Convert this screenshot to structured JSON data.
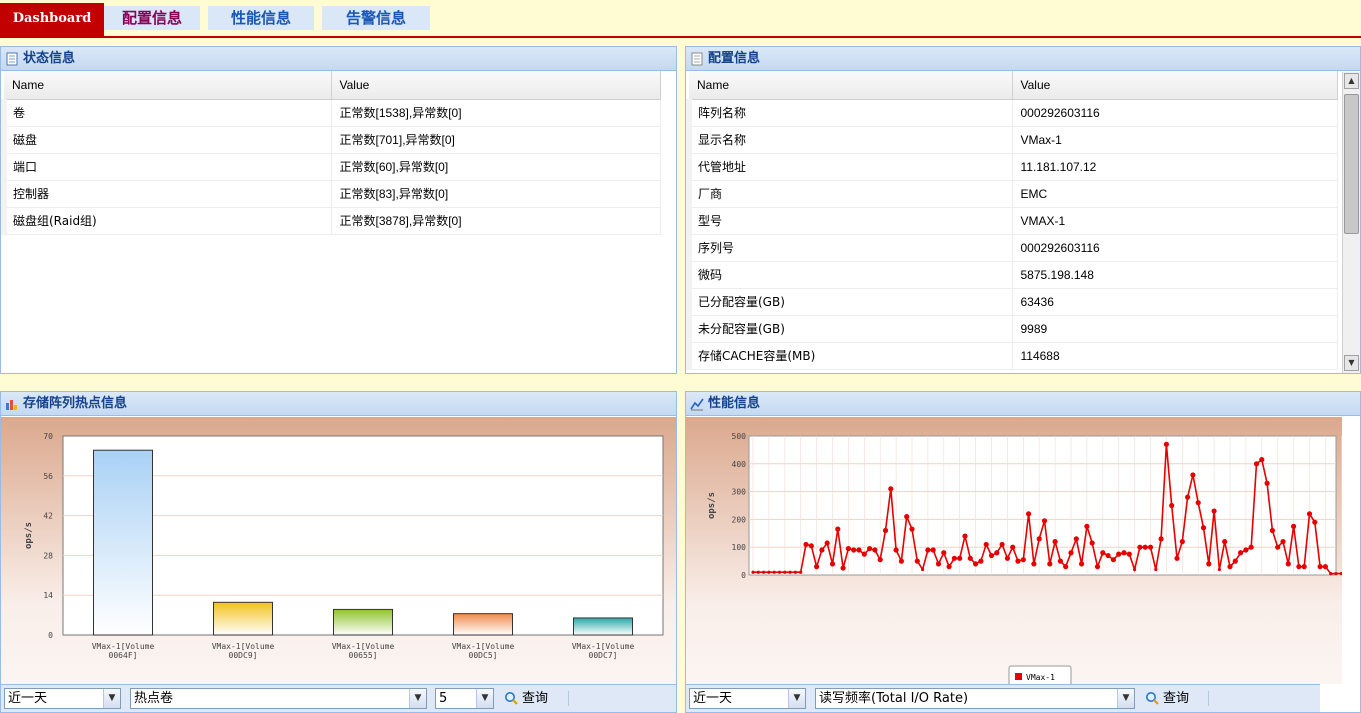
{
  "tabs": [
    "Dashboard",
    "配置信息",
    "性能信息",
    "告警信息"
  ],
  "status_panel": {
    "title": "状态信息",
    "columns": [
      "Name",
      "Value"
    ],
    "rows": [
      {
        "name": "卷",
        "value": "正常数[1538],异常数[0]"
      },
      {
        "name": "磁盘",
        "value": "正常数[701],异常数[0]"
      },
      {
        "name": "端口",
        "value": "正常数[60],异常数[0]"
      },
      {
        "name": "控制器",
        "value": "正常数[83],异常数[0]"
      },
      {
        "name": "磁盘组(Raid组)",
        "value": "正常数[3878],异常数[0]"
      }
    ]
  },
  "config_panel": {
    "title": "配置信息",
    "columns": [
      "Name",
      "Value"
    ],
    "rows": [
      {
        "name": "阵列名称",
        "value": "000292603116"
      },
      {
        "name": "显示名称",
        "value": "VMax-1"
      },
      {
        "name": "代管地址",
        "value": "11.181.107.12"
      },
      {
        "name": "厂商",
        "value": "EMC"
      },
      {
        "name": "型号",
        "value": "VMAX-1"
      },
      {
        "name": "序列号",
        "value": "000292603116"
      },
      {
        "name": "微码",
        "value": "5875.198.148"
      },
      {
        "name": "已分配容量(GB)",
        "value": "63436"
      },
      {
        "name": "未分配容量(GB)",
        "value": "9989"
      },
      {
        "name": "存储CACHE容量(MB)",
        "value": "114688"
      }
    ]
  },
  "hotspot_panel": {
    "title": "存储阵列热点信息",
    "toolbar": {
      "range": "近一天",
      "type": "热点卷",
      "count": "5",
      "query": "查询"
    }
  },
  "perf_panel": {
    "title": "性能信息",
    "toolbar": {
      "range": "近一天",
      "metric": "读写频率(Total I/O Rate)",
      "query": "查询"
    }
  },
  "chart_data": [
    {
      "type": "bar",
      "ylabel": "ops/s",
      "ylim": [
        0,
        70
      ],
      "yticks": [
        0,
        14,
        28,
        42,
        56,
        70
      ],
      "categories": [
        "VMax-1[Volume 0064F]",
        "VMax-1[Volume 00DC9]",
        "VMax-1[Volume 00655]",
        "VMax-1[Volume 00DC5]",
        "VMax-1[Volume 00DC7]"
      ],
      "category_lines": [
        [
          "VMax-1[Volume",
          "0064F]"
        ],
        [
          "VMax-1[Volume",
          "00DC9]"
        ],
        [
          "VMax-1[Volume",
          "00655]"
        ],
        [
          "VMax-1[Volume",
          "00DC5]"
        ],
        [
          "VMax-1[Volume",
          "00DC7]"
        ]
      ],
      "values": [
        65,
        11.5,
        9,
        7.5,
        6
      ],
      "colors": [
        "#a9d1f5",
        "#f2c21c",
        "#8fc42a",
        "#f08a4b",
        "#2aa7a8"
      ],
      "grid": true
    },
    {
      "type": "line",
      "ylabel": "ops/s",
      "ylim": [
        0,
        500
      ],
      "yticks": [
        0,
        100,
        200,
        300,
        400,
        500
      ],
      "series": [
        {
          "name": "VMax-1",
          "color": "#e60000",
          "values": [
            10,
            10,
            10,
            10,
            10,
            10,
            10,
            10,
            10,
            10,
            110,
            105,
            30,
            90,
            115,
            40,
            165,
            25,
            95,
            90,
            90,
            75,
            95,
            90,
            55,
            160,
            310,
            90,
            50,
            210,
            165,
            50,
            20,
            90,
            90,
            40,
            80,
            30,
            60,
            60,
            140,
            60,
            40,
            50,
            110,
            70,
            80,
            110,
            60,
            100,
            50,
            55,
            220,
            40,
            130,
            195,
            40,
            120,
            50,
            30,
            80,
            130,
            40,
            175,
            115,
            30,
            80,
            70,
            55,
            75,
            80,
            75,
            20,
            100,
            100,
            100,
            20,
            130,
            470,
            250,
            60,
            120,
            280,
            360,
            260,
            170,
            40,
            230,
            20,
            120,
            30,
            50,
            80,
            90,
            100,
            400,
            415,
            330,
            160,
            100,
            120,
            40,
            175,
            30,
            30,
            220,
            190,
            30,
            30,
            5,
            5,
            5
          ]
        }
      ],
      "grid": true,
      "legend": "bottom-center"
    }
  ]
}
